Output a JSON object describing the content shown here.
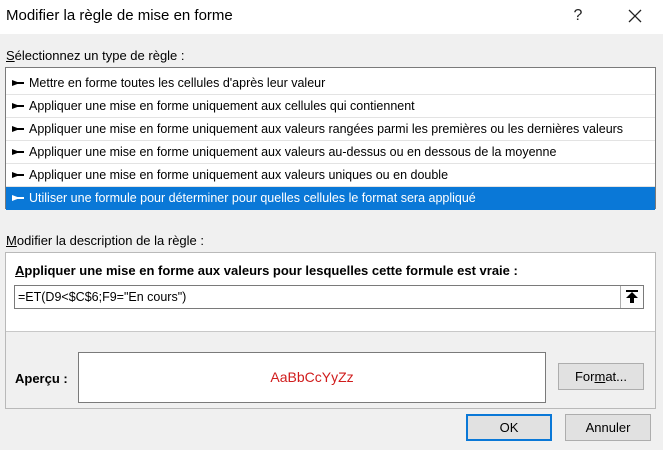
{
  "dialog": {
    "title": "Modifier la règle de mise en forme",
    "help_label": "?"
  },
  "rule_type": {
    "label_prefix": "S",
    "label_rest": "électionnez un type de règle :",
    "items": [
      {
        "label": "Mettre en forme toutes les cellules d'après leur valeur"
      },
      {
        "label": "Appliquer une mise en forme uniquement aux cellules qui contiennent"
      },
      {
        "label": "Appliquer une mise en forme uniquement aux valeurs rangées parmi les premières ou les dernières valeurs"
      },
      {
        "label": "Appliquer une mise en forme uniquement aux valeurs au-dessus ou en dessous de la moyenne"
      },
      {
        "label": "Appliquer une mise en forme uniquement aux valeurs uniques ou en double"
      },
      {
        "label": "Utiliser une formule pour déterminer pour quelles cellules le format sera appliqué",
        "selected": true
      }
    ]
  },
  "description": {
    "label_prefix": "M",
    "label_rest": "odifier la description de la règle :",
    "heading_prefix": "A",
    "heading_rest": "ppliquer une mise en forme aux valeurs pour lesquelles cette formule est vraie :",
    "formula": "=ET(D9<$C$6;F9=\"En cours\")",
    "preview_label": "Aperçu :",
    "preview_text": "AaBbCcYyZz",
    "preview_color": "#d01c1c"
  },
  "buttons": {
    "format_prefix": "For",
    "format_underline": "m",
    "format_rest": "at...",
    "ok": "OK",
    "cancel": "Annuler"
  },
  "colors": {
    "selection": "#0a78d7"
  }
}
